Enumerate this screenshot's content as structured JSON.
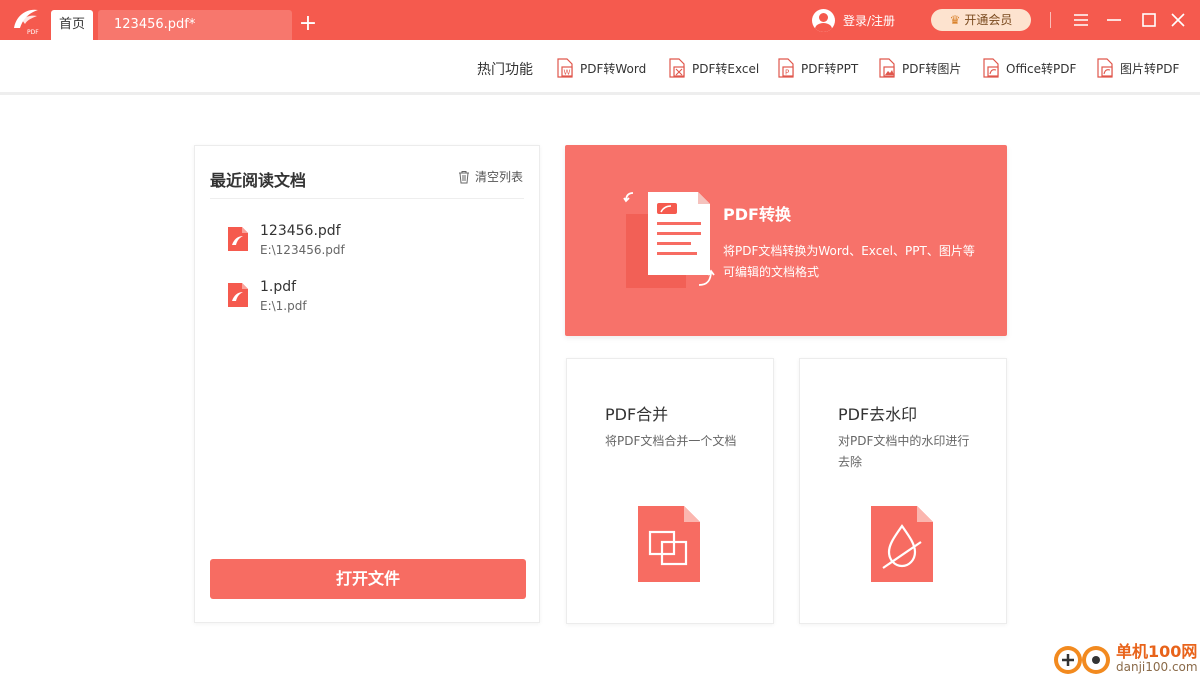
{
  "titlebar": {
    "tabs": [
      {
        "label": "首页"
      },
      {
        "label": "123456.pdf*"
      }
    ],
    "add_tab": "+",
    "login_label": "登录/注册",
    "vip_label": "开通会员",
    "logo_text": "PDF"
  },
  "toolbar": {
    "hot_label": "热门功能",
    "items": [
      {
        "label": "PDF转Word",
        "icon": "pdf-to-word-icon"
      },
      {
        "label": "PDF转Excel",
        "icon": "pdf-to-excel-icon"
      },
      {
        "label": "PDF转PPT",
        "icon": "pdf-to-ppt-icon"
      },
      {
        "label": "PDF转图片",
        "icon": "pdf-to-image-icon"
      },
      {
        "label": "Office转PDF",
        "icon": "office-to-pdf-icon"
      },
      {
        "label": "图片转PDF",
        "icon": "image-to-pdf-icon"
      }
    ]
  },
  "recent": {
    "title": "最近阅读文档",
    "clear_label": "清空列表",
    "files": [
      {
        "name": "123456.pdf",
        "path": "E:\\123456.pdf"
      },
      {
        "name": "1.pdf",
        "path": "E:\\1.pdf"
      }
    ],
    "open_button": "打开文件"
  },
  "cards": {
    "convert": {
      "title": "PDF转换",
      "desc": "将PDF文档转换为Word、Excel、PPT、图片等可编辑的文档格式"
    },
    "merge": {
      "title": "PDF合并",
      "desc": "将PDF文档合并一个文档"
    },
    "watermark": {
      "title": "PDF去水印",
      "desc": "对PDF文档中的水印进行去除"
    }
  },
  "site_mark": {
    "name": "单机100网",
    "url": "danji100.com"
  },
  "colors": {
    "brand": "#f55a4e",
    "accent": "#f76c62",
    "vip_bg": "#fde3cf"
  }
}
